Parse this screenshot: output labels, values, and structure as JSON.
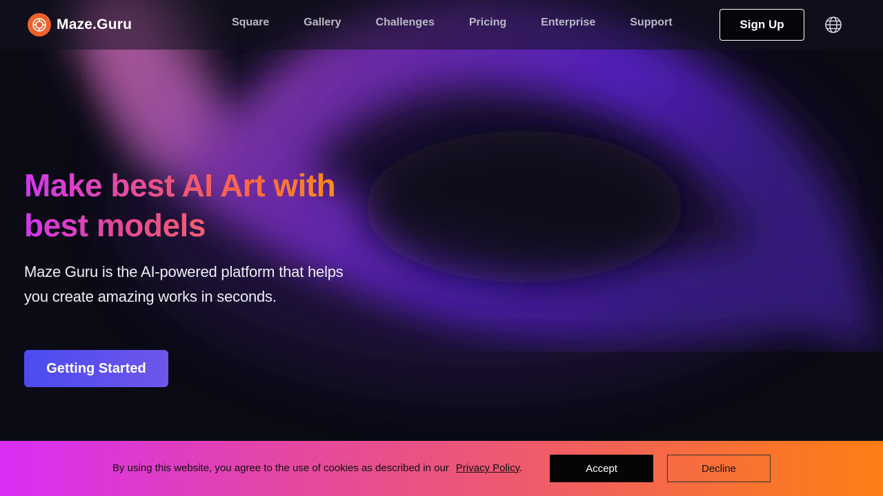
{
  "header": {
    "logo_text": "Maze.Guru",
    "nav": [
      "Square",
      "Gallery",
      "Challenges",
      "Pricing",
      "Enterprise",
      "Support"
    ],
    "signup_label": "Sign Up",
    "language_icon": "globe-icon"
  },
  "hero": {
    "title_line1": "Make best AI Art with",
    "title_line2": "best models",
    "subtitle_line1": "Maze Guru is the AI-powered platform that helps",
    "subtitle_line2": "you create amazing works in seconds.",
    "cta_label": "Getting Started"
  },
  "cookie": {
    "message": "By using this website, you agree to the use of cookies as described in our",
    "link_label": "Privacy Policy",
    "link_suffix": ".",
    "accept_label": "Accept",
    "decline_label": "Decline"
  },
  "colors": {
    "background": "#0b0b16",
    "accent_purple": "#5a26c9",
    "accent_pink": "#d236f0",
    "accent_orange": "#ff7e14",
    "cta_blue": "#4b4bf0"
  }
}
